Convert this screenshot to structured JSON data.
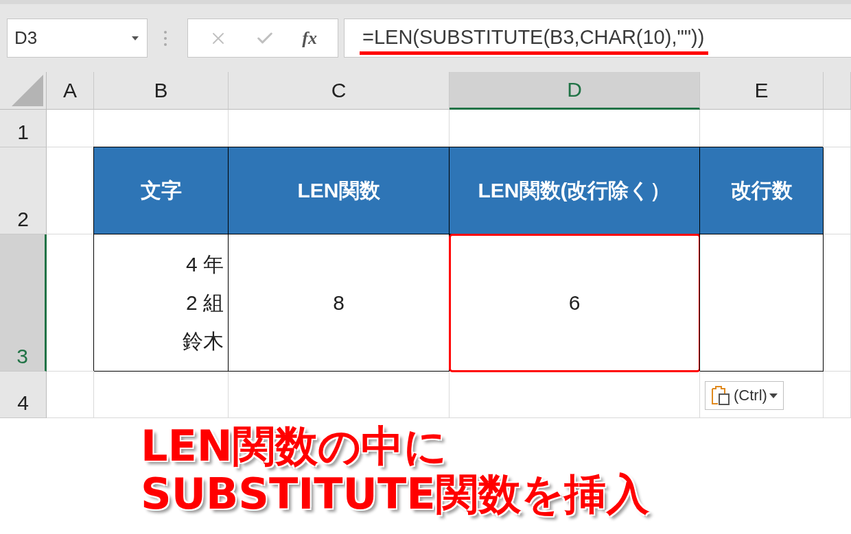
{
  "name_box": {
    "value": "D3"
  },
  "formula_bar": {
    "function_button": "fx",
    "formula": "=LEN(SUBSTITUTE(B3,CHAR(10),\"\"))",
    "underlined": true
  },
  "columns": [
    {
      "label": "A",
      "selected": false
    },
    {
      "label": "B",
      "selected": false
    },
    {
      "label": "C",
      "selected": false
    },
    {
      "label": "D",
      "selected": true
    },
    {
      "label": "E",
      "selected": false
    }
  ],
  "rows": [
    {
      "label": "1",
      "selected": false
    },
    {
      "label": "2",
      "selected": false,
      "cells": [
        {
          "kind": "empty"
        },
        {
          "kind": "header",
          "text": "文字"
        },
        {
          "kind": "header",
          "text": "LEN関数"
        },
        {
          "kind": "header",
          "text": "LEN関数(改行除く）"
        },
        {
          "kind": "header",
          "text": "改行数"
        }
      ]
    },
    {
      "label": "3",
      "selected": true,
      "cells": [
        {
          "kind": "empty"
        },
        {
          "kind": "lines",
          "lines": [
            "4 年",
            "2 組",
            "鈴木"
          ],
          "highlighted": false
        },
        {
          "kind": "data",
          "text": "8",
          "highlighted": false
        },
        {
          "kind": "data",
          "text": "6",
          "highlighted": true
        },
        {
          "kind": "data",
          "highlighted": false
        }
      ]
    },
    {
      "label": "4",
      "selected": false
    }
  ],
  "paste_options": {
    "label": "(Ctrl)"
  },
  "caption": "LEN関数の中に\nSUBSTITUTE関数を挿入"
}
